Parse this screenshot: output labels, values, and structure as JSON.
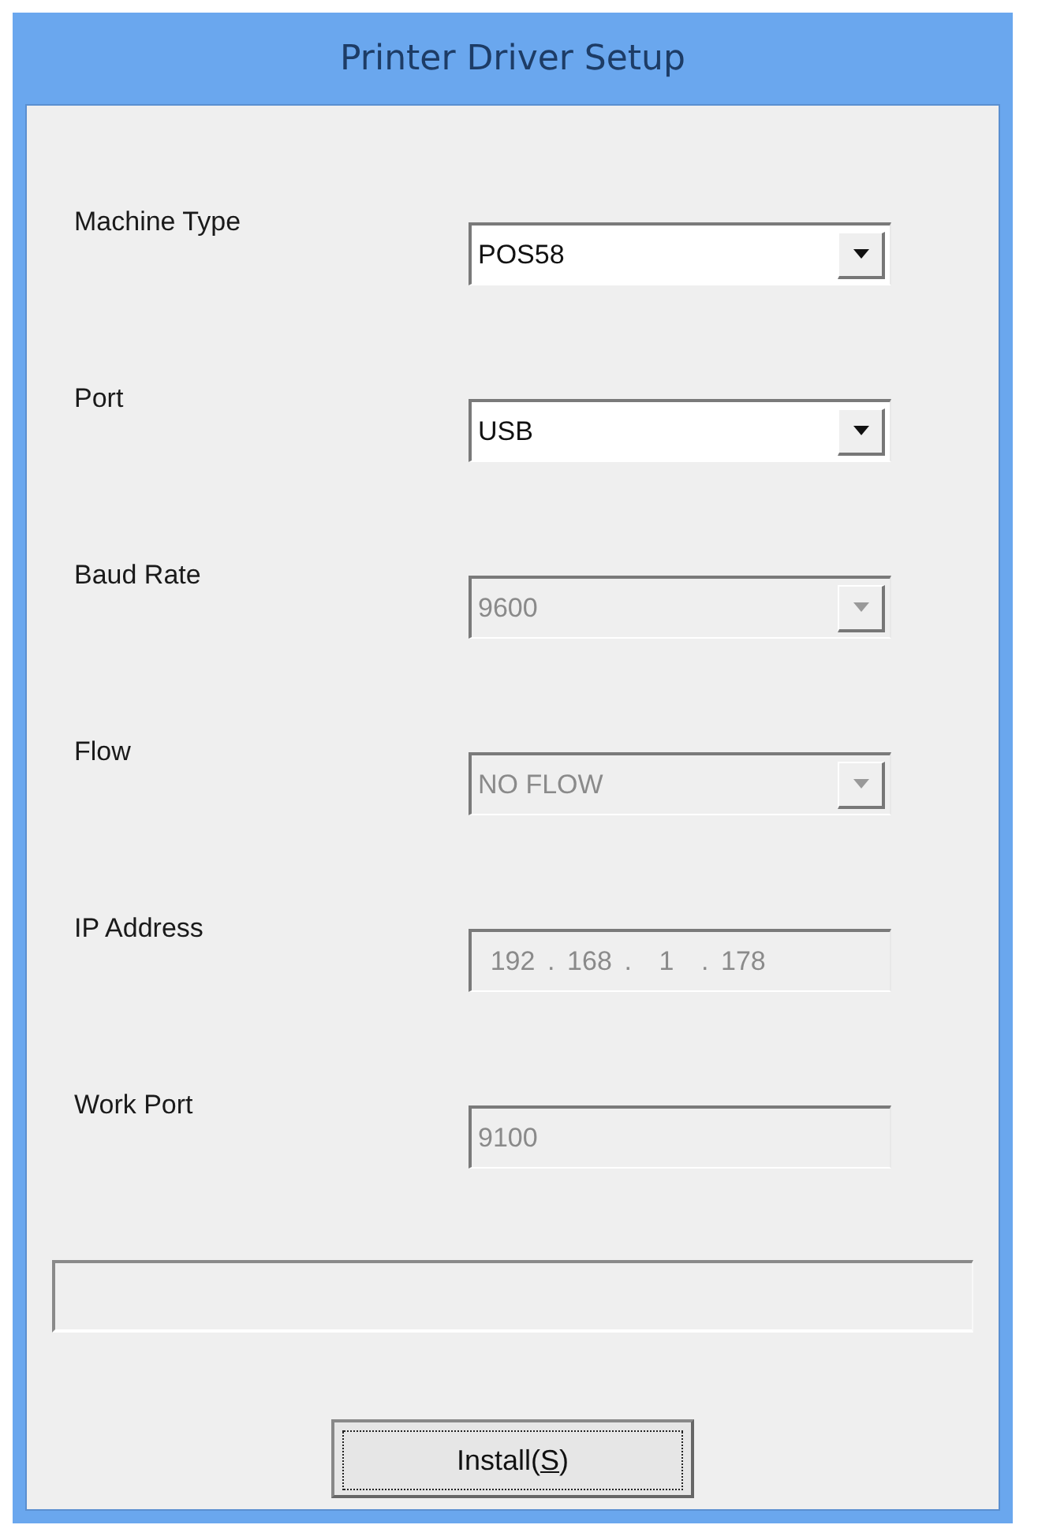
{
  "window": {
    "title": "Printer Driver Setup"
  },
  "fields": [
    {
      "label": "Machine Type",
      "kind": "dropdown",
      "value": "POS58",
      "disabled": false
    },
    {
      "label": "Port",
      "kind": "dropdown",
      "value": "USB",
      "disabled": false
    },
    {
      "label": "Baud Rate",
      "kind": "dropdown",
      "value": "9600",
      "disabled": true
    },
    {
      "label": "Flow",
      "kind": "dropdown",
      "value": "NO FLOW",
      "disabled": true
    },
    {
      "label": "IP Address",
      "kind": "ip",
      "octets": [
        "192",
        "168",
        "1",
        "178"
      ],
      "separator": ".",
      "disabled": true
    },
    {
      "label": "Work Port",
      "kind": "text",
      "value": "9100",
      "disabled": true
    }
  ],
  "install_button": {
    "label": "Install(S)",
    "mnemonic": true,
    "focused": true
  }
}
